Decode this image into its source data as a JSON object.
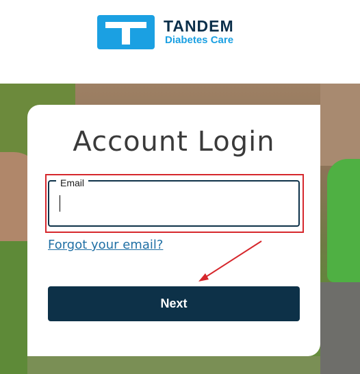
{
  "brand": {
    "name": "TANDEM",
    "tagline": "Diabetes Care",
    "primary_color": "#1ba0e2",
    "dark_color": "#0b2f4a"
  },
  "login": {
    "title": "Account Login",
    "email_label": "Email",
    "email_value": "",
    "forgot_link": "Forgot your email?",
    "next_button": "Next"
  },
  "annotation": {
    "highlight_color": "#d6272c",
    "arrow_color": "#d6272c"
  }
}
